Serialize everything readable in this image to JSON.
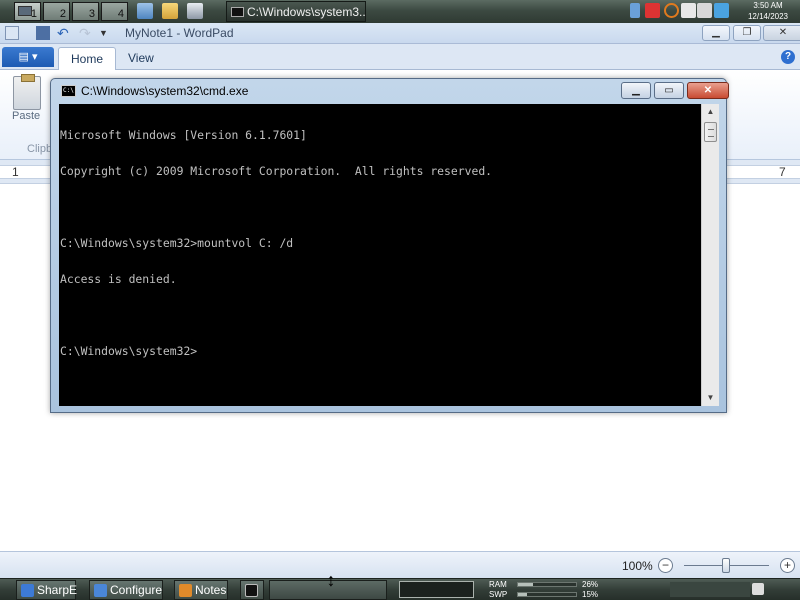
{
  "top_taskbar": {
    "virtual_desktops": [
      "1",
      "2",
      "3",
      "4"
    ],
    "active_window_button": "C:\\Windows\\system3...",
    "clock": {
      "time": "3:50 AM",
      "date": "12/14/2023"
    }
  },
  "wordpad": {
    "title": "MyNote1 - WordPad",
    "tabs": [
      {
        "label": "Home",
        "active": true
      },
      {
        "label": "View",
        "active": false
      }
    ],
    "ribbon": {
      "paste_label": "Paste",
      "group_clipboard": "Clipb"
    },
    "ruler": {
      "left_num": "1",
      "right_num": "7"
    },
    "status": {
      "zoom_level": "100%",
      "zoom_out": "−",
      "zoom_in": "+"
    }
  },
  "cmd": {
    "title": "C:\\Windows\\system32\\cmd.exe",
    "icon_text": "C:\\",
    "lines": [
      "Microsoft Windows [Version 6.1.7601]",
      "Copyright (c) 2009 Microsoft Corporation.  All rights reserved.",
      "",
      "C:\\Windows\\system32>mountvol C: /d",
      "Access is denied.",
      "",
      "C:\\Windows\\system32>"
    ]
  },
  "bottom_taskbar": {
    "buttons": [
      {
        "label": "SharpE",
        "color": "#3d7ad6"
      },
      {
        "label": "Configure",
        "color": "#4a86d8"
      },
      {
        "label": "Notes",
        "color": "#e08a2a"
      }
    ],
    "meters": [
      {
        "label": "RAM",
        "value": "26%",
        "fill": 0.26
      },
      {
        "label": "SWP",
        "value": "15%",
        "fill": 0.15
      }
    ]
  },
  "colors": {
    "console_bg": "#000000",
    "console_fg": "#c0c0c0",
    "ribbon_blue": "#1d5bb3"
  }
}
